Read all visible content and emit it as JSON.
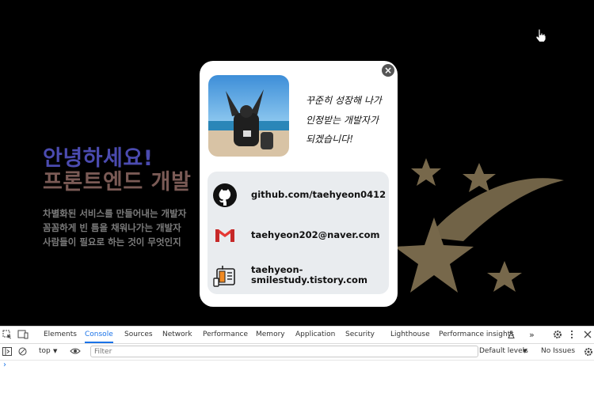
{
  "hero": {
    "greeting": "안녕하세요!",
    "role": "프론트엔드 개발",
    "desc1": "차별화된 서비스를 만들어내는 개발자",
    "desc2": "꼼꼼하게 빈 틈을 채워나가는 개발자",
    "desc3": "사람들이 필요로 하는 것이 무엇인지"
  },
  "modal": {
    "close_label": "×",
    "motto": [
      "꾸준히 성장해 나가",
      "인정받는 개발자가",
      "되겠습니다!"
    ],
    "links": [
      {
        "icon": "github-icon",
        "text": "github.com/taehyeon0412"
      },
      {
        "icon": "gmail-icon",
        "text": "taehyeon202@naver.com"
      },
      {
        "icon": "blog-icon",
        "text_line1": "taehyeon-",
        "text_line2": "smilestudy.tistory.com"
      }
    ]
  },
  "devtools": {
    "tabs": [
      "Elements",
      "Console",
      "Sources",
      "Network",
      "Performance",
      "Memory",
      "Application",
      "Security",
      "Lighthouse",
      "Performance insights"
    ],
    "active_tab": "Console",
    "more": "»",
    "context": "top",
    "filter_placeholder": "Filter",
    "levels": "Default levels",
    "issues": "No Issues",
    "prompt": "›"
  },
  "colors": {
    "accent": "#1a73e8",
    "star": "#77684b",
    "modal_bg": "#ffffff",
    "links_bg": "#e9ecef"
  }
}
